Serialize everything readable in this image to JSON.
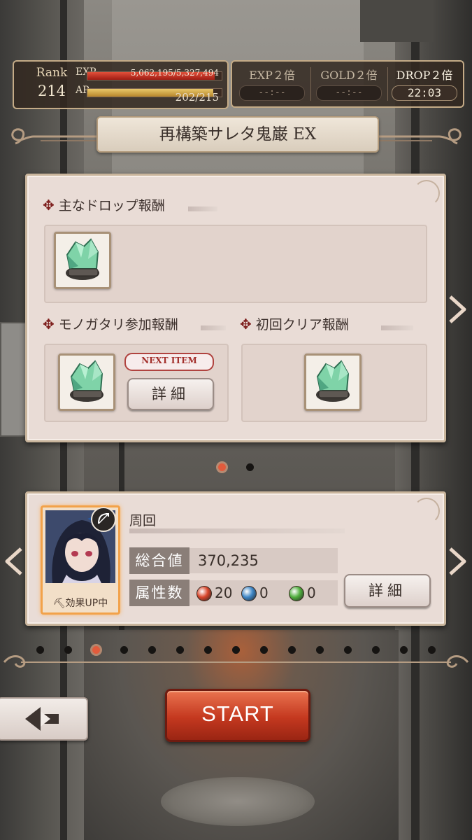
{
  "player": {
    "rank_label": "Rank",
    "rank_value": "214",
    "exp_label": "EXP",
    "exp_value": "5,062,195/5,327,494",
    "exp_fill": 0.95,
    "ap_label": "AP",
    "ap_value": "202/215",
    "ap_fill": 0.94
  },
  "boosts": [
    {
      "label": "EXP２倍",
      "time": "--:--",
      "active": false
    },
    {
      "label": "GOLD２倍",
      "time": "--:--",
      "active": false
    },
    {
      "label": "DROP２倍",
      "time": "22:03",
      "active": true
    }
  ],
  "quest": {
    "title": "再構築サレタ鬼巌 EX"
  },
  "rewards": {
    "main_drop_title": "主なドロップ報酬",
    "participation_title": "モノガタリ参加報酬",
    "first_clear_title": "初回クリア報酬",
    "next_item_badge": "NEXT ITEM",
    "detail_button": "詳細"
  },
  "party": {
    "name": "周回",
    "total_label": "総合値",
    "total_value": "370,235",
    "attribute_label": "属性数",
    "attributes": [
      {
        "color": "#d8452a",
        "count": "20"
      },
      {
        "color": "#3e86c6",
        "count": "0"
      },
      {
        "color": "#4fae3d",
        "count": "0"
      }
    ],
    "effect_label": "効果UP中",
    "detail_button": "詳細"
  },
  "pager_top": {
    "count": 2,
    "active": 0
  },
  "pager_bottom": {
    "count": 15,
    "active": 2
  },
  "start_button": "START",
  "colors": {
    "panel": "#e9dcd6",
    "accent_red": "#c4381f",
    "gold_border": "#c4ab87"
  }
}
